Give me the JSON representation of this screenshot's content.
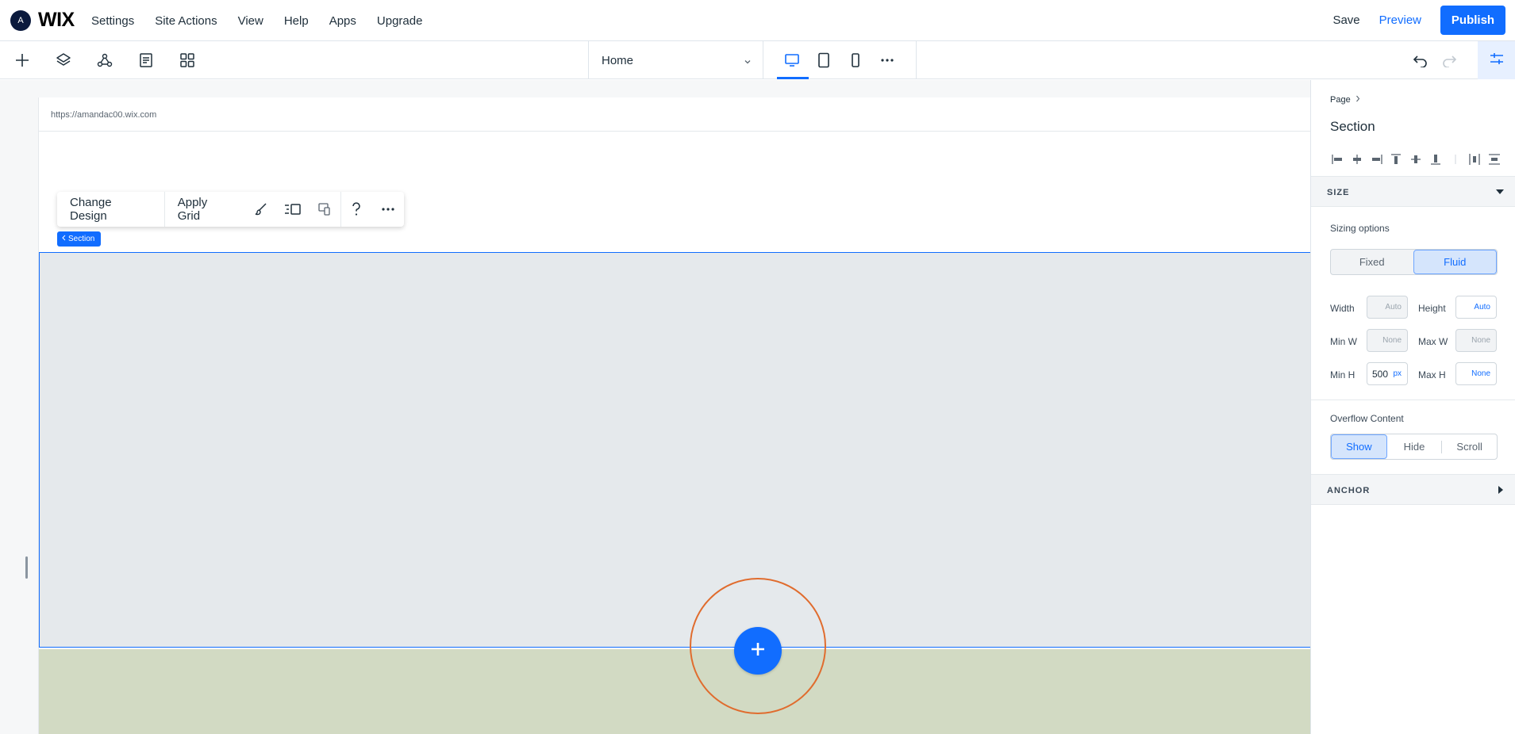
{
  "topbar": {
    "avatar_letter": "A",
    "logo": "WIX",
    "menu": [
      "Settings",
      "Site Actions",
      "View",
      "Help",
      "Apps",
      "Upgrade"
    ],
    "save": "Save",
    "preview": "Preview",
    "publish": "Publish"
  },
  "toolbar": {
    "tools": [
      "add-icon",
      "layers-icon",
      "site-structure-icon",
      "pages-icon",
      "apps-grid-icon"
    ],
    "page_selector": "Home",
    "devices": [
      "desktop-icon",
      "tablet-icon",
      "mobile-icon",
      "more-icon"
    ],
    "active_device": "desktop"
  },
  "canvas": {
    "url": "https://amandac00.wix.com",
    "context_toolbar": {
      "change_design": "Change Design",
      "apply_grid": "Apply Grid"
    },
    "section_tag": "Section"
  },
  "panel": {
    "breadcrumb": "Page",
    "title": "Section",
    "size_header": "SIZE",
    "sizing_label": "Sizing options",
    "sizing_options": [
      "Fixed",
      "Fluid"
    ],
    "sizing_selected": "Fluid",
    "fields": {
      "width_label": "Width",
      "width_value": "Auto",
      "height_label": "Height",
      "height_value": "Auto",
      "min_w_label": "Min W",
      "min_w_value": "None",
      "max_w_label": "Max W",
      "max_w_value": "None",
      "min_h_label": "Min H",
      "min_h_value": "500",
      "min_h_unit": "px",
      "max_h_label": "Max H",
      "max_h_value": "None"
    },
    "overflow_label": "Overflow Content",
    "overflow_options": [
      "Show",
      "Hide",
      "Scroll"
    ],
    "overflow_selected": "Show",
    "anchor_header": "ANCHOR"
  },
  "colors": {
    "accent": "#116dff",
    "ring": "#e06c2e",
    "section_bg": "#e5e9ec",
    "next_section_bg": "#d2dac3"
  }
}
